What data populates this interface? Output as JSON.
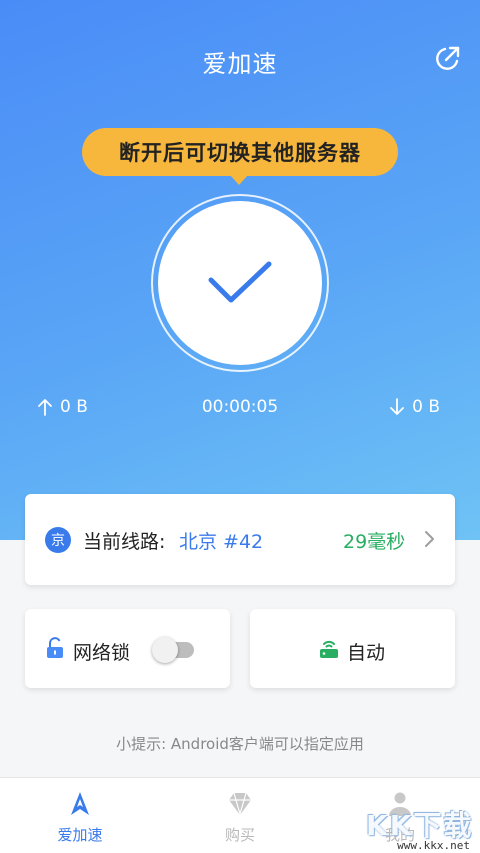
{
  "header": {
    "title": "爱加速",
    "action_icon": "share-icon"
  },
  "tooltip": {
    "text": "断开后可切换其他服务器"
  },
  "connection": {
    "status": "connected",
    "upload": "0 B",
    "elapsed": "00:00:05",
    "download": "0 B"
  },
  "route": {
    "badge": "京",
    "label": "当前线路:",
    "server": "北京 #42",
    "latency": "29毫秒"
  },
  "network_lock": {
    "label": "网络锁",
    "enabled": false
  },
  "mode": {
    "label": "自动"
  },
  "tip": "小提示: Android客户端可以指定应用",
  "tabs": [
    {
      "label": "爱加速",
      "icon": "rocket-icon",
      "active": true
    },
    {
      "label": "购买",
      "icon": "diamond-icon",
      "active": false
    },
    {
      "label": "我的",
      "icon": "person-icon",
      "active": false
    }
  ],
  "watermark": {
    "text": "KK下载",
    "url": "www.kkx.net"
  },
  "colors": {
    "accent": "#3a7bec",
    "tooltip": "#f6b73c",
    "latency": "#27ae60",
    "hero_gradient_start": "#4a8cf7",
    "hero_gradient_end": "#6ec3f5"
  }
}
